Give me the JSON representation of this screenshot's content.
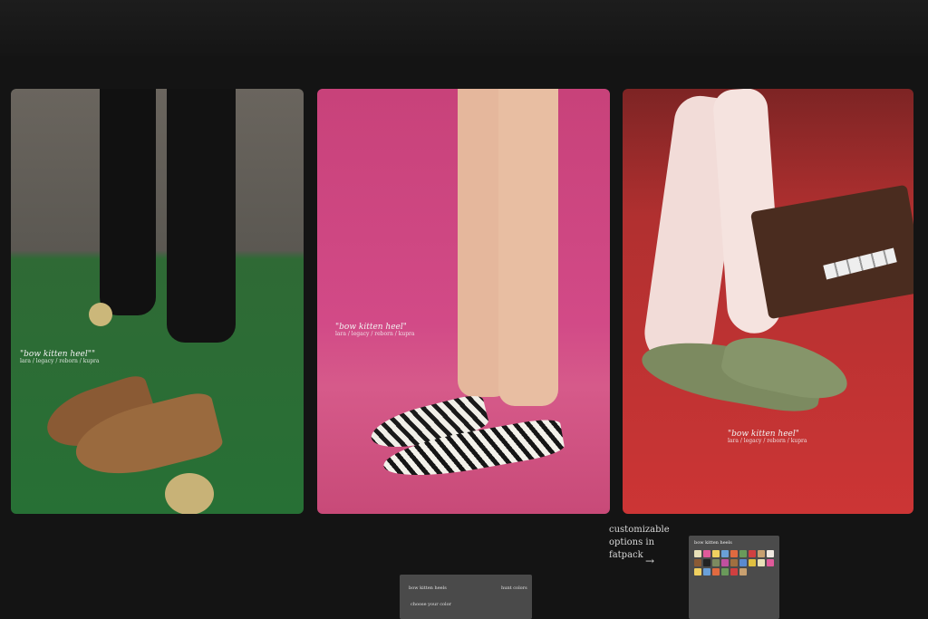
{
  "panels": [
    {
      "caption_title": "\"bow kitten heel\"\"",
      "caption_sub": "lara / legacy / reborn / kupra"
    },
    {
      "caption_title": "\"bow kitten heel\"",
      "caption_sub": "lara / legacy / reborn / kupra"
    },
    {
      "caption_title": "\"bow kitten heel\"",
      "caption_sub": "lara / legacy / reborn / kupra"
    }
  ],
  "bottom": {
    "note_line1": "customizable",
    "note_line2": "options in",
    "note_line3": "fatpack",
    "arrow": "→",
    "thumb1_left": "bow kitten heels",
    "thumb1_right": "hunt colors",
    "thumb1_sub": "choose your color",
    "thumb2_title": "bow kitten heels"
  },
  "colors": {
    "bg": "#141414",
    "panel1": "#277035",
    "panel2": "#d24a87",
    "panel3": "#cc3535"
  }
}
